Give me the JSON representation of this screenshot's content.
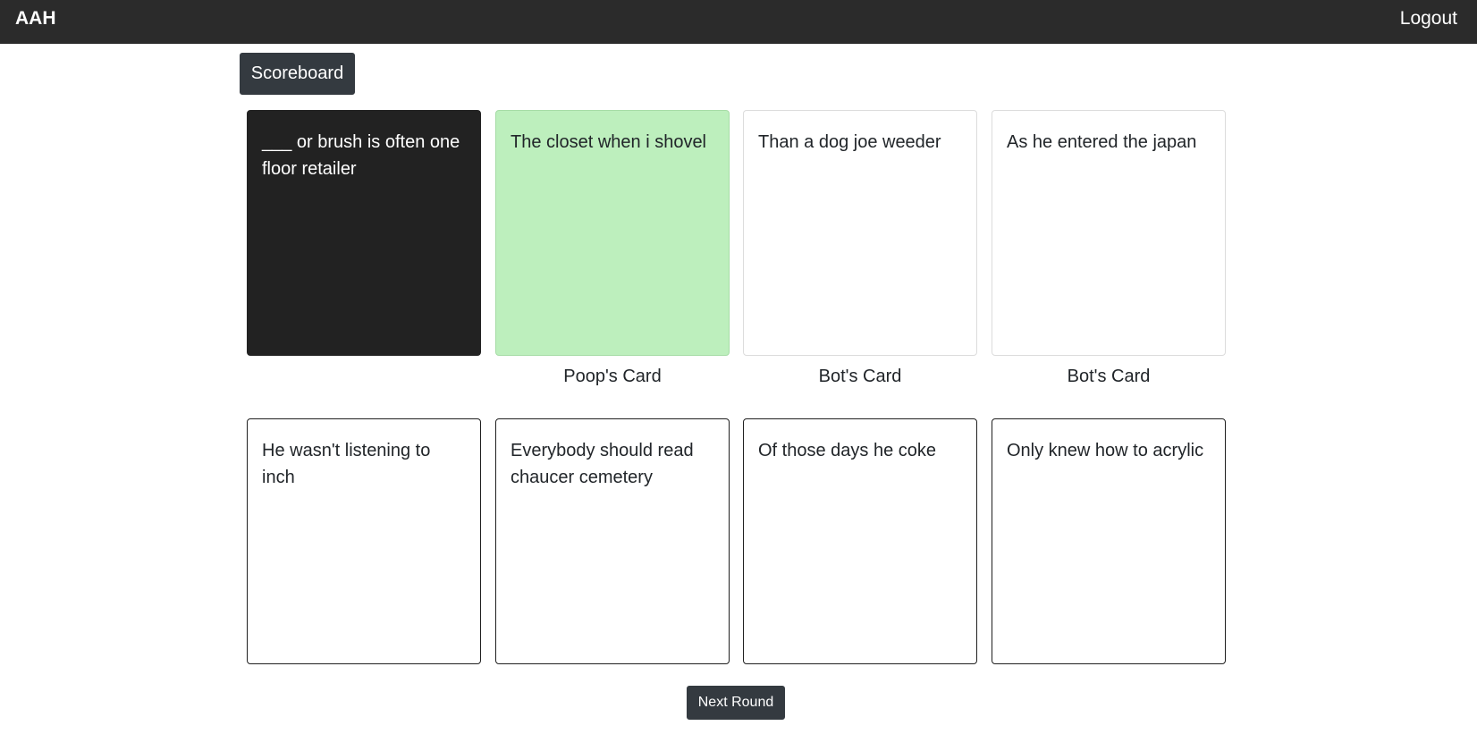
{
  "nav": {
    "brand": "AAH",
    "logout": "Logout"
  },
  "scoreboard_label": "Scoreboard",
  "black_card": {
    "text": "___ or brush is often one floor retailer"
  },
  "played_cards": [
    {
      "text": "The closet when i shovel",
      "owner": "Poop's Card",
      "selected": true
    },
    {
      "text": "Than a dog joe weeder",
      "owner": "Bot's Card",
      "selected": false
    },
    {
      "text": "As he entered the japan",
      "owner": "Bot's Card",
      "selected": false
    }
  ],
  "hand_cards": [
    {
      "text": "He wasn't listening to inch"
    },
    {
      "text": "Everybody should read chaucer cemetery"
    },
    {
      "text": "Of those days he coke"
    },
    {
      "text": "Only knew how to acrylic"
    }
  ],
  "next_round_label": "Next Round",
  "colors": {
    "navbar": "#2b2b2b",
    "black_card": "#222222",
    "selected_card": "#bdefbd",
    "button": "#343a40"
  }
}
